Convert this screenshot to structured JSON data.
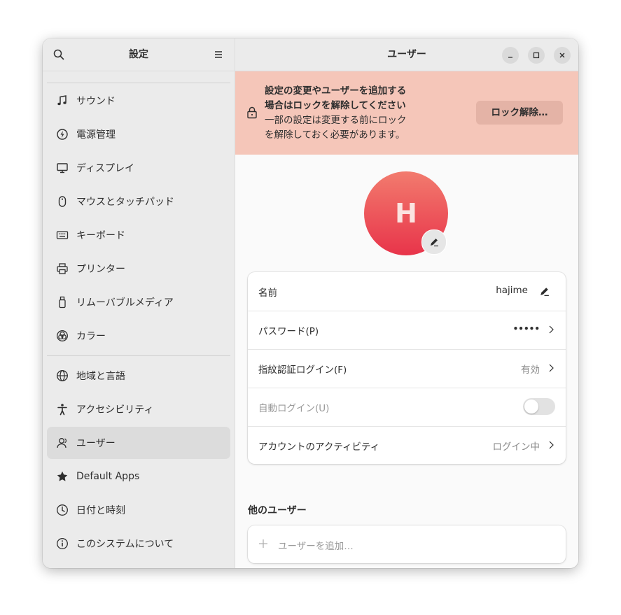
{
  "sidebar": {
    "title": "設定",
    "group1": [
      {
        "label": "サウンド",
        "icon": "music-note-icon"
      },
      {
        "label": "電源管理",
        "icon": "power-icon"
      },
      {
        "label": "ディスプレイ",
        "icon": "monitor-icon"
      },
      {
        "label": "マウスとタッチパッド",
        "icon": "mouse-icon"
      },
      {
        "label": "キーボード",
        "icon": "keyboard-icon"
      },
      {
        "label": "プリンター",
        "icon": "printer-icon"
      },
      {
        "label": "リムーバブルメディア",
        "icon": "usb-drive-icon"
      },
      {
        "label": "カラー",
        "icon": "color-icon"
      }
    ],
    "group2": [
      {
        "label": "地域と言語",
        "icon": "globe-icon"
      },
      {
        "label": "アクセシビリティ",
        "icon": "accessibility-icon"
      },
      {
        "label": "ユーザー",
        "icon": "users-icon",
        "selected": true
      },
      {
        "label": "Default Apps",
        "icon": "star-icon"
      },
      {
        "label": "日付と時刻",
        "icon": "clock-icon"
      },
      {
        "label": "このシステムについて",
        "icon": "info-icon"
      }
    ]
  },
  "header": {
    "title": "ユーザー"
  },
  "banner": {
    "line1": "設定の変更やユーザーを追加する",
    "line2": "場合はロックを解除してください",
    "line3": "一部の設定は変更する前にロック",
    "line4": "を解除しておく必要があります。",
    "button": "ロック解除…",
    "color": "#f5c6b9"
  },
  "avatar": {
    "initial": "H"
  },
  "user": {
    "name_label": "名前",
    "name_value": "hajime",
    "password_label": "パスワード(P)",
    "password_value": "•••••",
    "fingerprint_label": "指紋認証ログイン(F)",
    "fingerprint_value": "有効",
    "autologin_label": "自動ログイン(U)",
    "autologin_on": false,
    "activity_label": "アカウントのアクティビティ",
    "activity_value": "ログイン中"
  },
  "other_users": {
    "title": "他のユーザー",
    "add_label": "ユーザーを追加…"
  }
}
